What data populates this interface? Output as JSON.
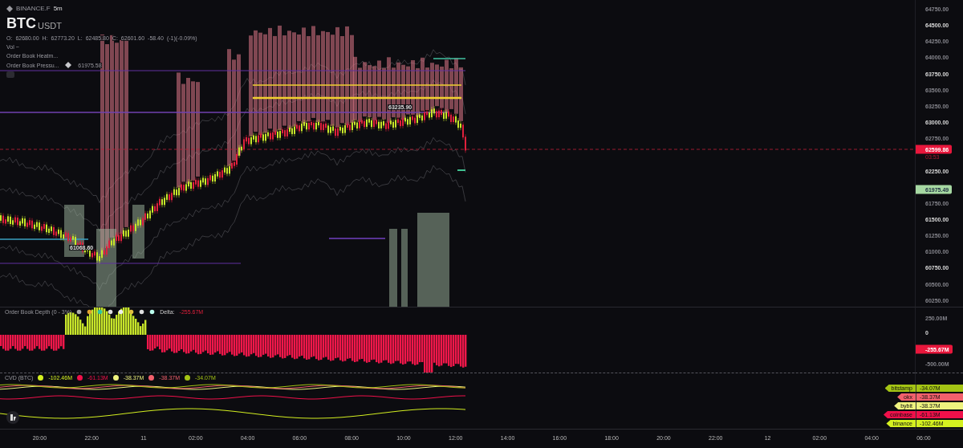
{
  "header": {
    "exchange": "BINANCE.F",
    "interval": "5m",
    "symbol": "BTC",
    "quote": "USDT",
    "ohlc": [
      {
        "label": "O:",
        "value": "62680.00"
      },
      {
        "label": "H:",
        "value": "62773.20"
      },
      {
        "label": "L:",
        "value": "62485.80"
      },
      {
        "label": "C:",
        "value": "62601.60"
      }
    ],
    "change": "-58.40",
    "change_pct": "(-1)(-0.09%)",
    "indicators": [
      {
        "label": "Vol ~"
      },
      {
        "label": "Order Book Heatm..."
      },
      {
        "label": "Order Book Pressu...",
        "value": "61975.58"
      }
    ]
  },
  "markers": [
    {
      "label": "63235.90"
    },
    {
      "label": "61068.60"
    }
  ],
  "price_axis": {
    "ticks": [
      {
        "label": "64750.00",
        "major": false
      },
      {
        "label": "64500.00",
        "major": true
      },
      {
        "label": "64250.00",
        "major": false
      },
      {
        "label": "64000.00",
        "major": false
      },
      {
        "label": "63750.00",
        "major": true
      },
      {
        "label": "63500.00",
        "major": false
      },
      {
        "label": "63250.00",
        "major": false
      },
      {
        "label": "63000.00",
        "major": true
      },
      {
        "label": "62750.00",
        "major": false
      },
      {
        "label": "62250.00",
        "major": true
      },
      {
        "label": "61750.00",
        "major": false
      },
      {
        "label": "61500.00",
        "major": true
      },
      {
        "label": "61250.00",
        "major": false
      },
      {
        "label": "61000.00",
        "major": false
      },
      {
        "label": "60750.00",
        "major": true
      },
      {
        "label": "60500.00",
        "major": false
      },
      {
        "label": "60250.00",
        "major": false
      }
    ],
    "last_price": "62599.86",
    "countdown": "03:53",
    "pressure_price": "61975.49"
  },
  "depth": {
    "title": "Order Book Depth (0 - 3%)",
    "delta_label": "Delta:",
    "delta": "-255.67M",
    "ticks": [
      {
        "label": "250.00M",
        "major": false
      },
      {
        "label": "0",
        "major": true
      },
      {
        "label": "-500.00M",
        "major": false
      }
    ],
    "current": "-255.67M"
  },
  "cvd": {
    "title": "CVD (BTC)",
    "series": [
      {
        "value": "-102.46M",
        "color": "#d4f020"
      },
      {
        "value": "-61.13M",
        "color": "#f0104a"
      },
      {
        "value": "-38.37M",
        "color": "#eef27e"
      },
      {
        "value": "-38.37M",
        "color": "#f2606c"
      },
      {
        "value": "-34.07M",
        "color": "#a4c414"
      }
    ],
    "legend": [
      {
        "exchange": "bitstamp",
        "value": "-34.07M",
        "color": "#a4c414"
      },
      {
        "exchange": "okx",
        "value": "-38.37M",
        "color": "#f2606c"
      },
      {
        "exchange": "bybit",
        "value": "-38.37M",
        "color": "#eef27e"
      },
      {
        "exchange": "coinbase",
        "value": "-61.13M",
        "color": "#f0104a"
      },
      {
        "exchange": "binance",
        "value": "-102.46M",
        "color": "#d4f020"
      }
    ]
  },
  "time_axis": [
    "20:00",
    "22:00",
    "11",
    "02:00",
    "04:00",
    "06:00",
    "08:00",
    "10:00",
    "12:00",
    "14:00",
    "16:00",
    "18:00",
    "20:00",
    "22:00",
    "12",
    "02:00",
    "04:00",
    "06:00"
  ]
}
